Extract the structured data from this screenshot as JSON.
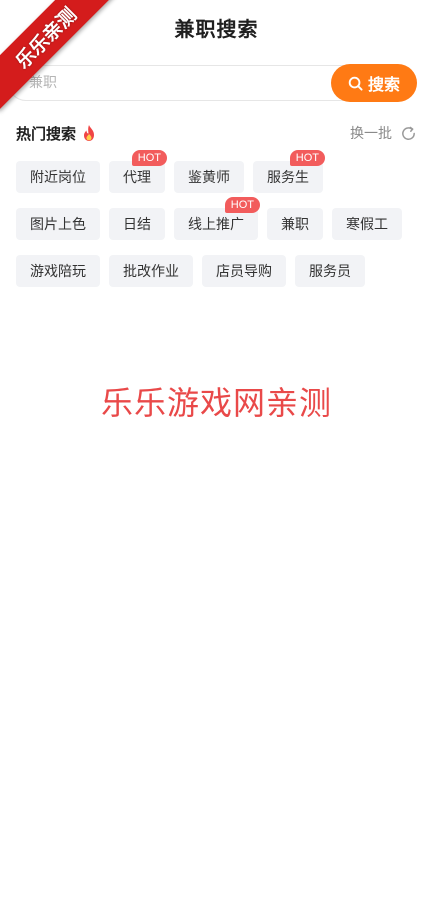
{
  "header": {
    "title": "兼职搜索"
  },
  "ribbon": {
    "text": "乐乐亲测"
  },
  "search": {
    "placeholder": "兼职",
    "value": "",
    "button_label": "搜索"
  },
  "hot": {
    "title": "热门搜索",
    "refresh_label": "换一批",
    "badge_label": "HOT",
    "rows": [
      [
        {
          "label": "附近岗位",
          "hot": false
        },
        {
          "label": "代理",
          "hot": true
        },
        {
          "label": "鉴黄师",
          "hot": false
        },
        {
          "label": "服务生",
          "hot": true
        }
      ],
      [
        {
          "label": "图片上色",
          "hot": false
        },
        {
          "label": "日结",
          "hot": false
        },
        {
          "label": "线上推广",
          "hot": true
        },
        {
          "label": "兼职",
          "hot": false
        },
        {
          "label": "寒假工",
          "hot": false
        }
      ],
      [
        {
          "label": "游戏陪玩",
          "hot": false
        },
        {
          "label": "批改作业",
          "hot": false
        },
        {
          "label": "店员导购",
          "hot": false
        },
        {
          "label": "服务员",
          "hot": false
        }
      ]
    ]
  },
  "watermark": {
    "text": "乐乐游戏网亲测"
  },
  "colors": {
    "accent": "#ff7a14",
    "hot_badge": "#f25c5c",
    "ribbon": "#d41c1c",
    "watermark": "#e94949",
    "tag_bg": "#f2f3f6"
  },
  "icons": {
    "search": "search-icon",
    "fire": "fire-icon",
    "refresh": "refresh-icon"
  }
}
